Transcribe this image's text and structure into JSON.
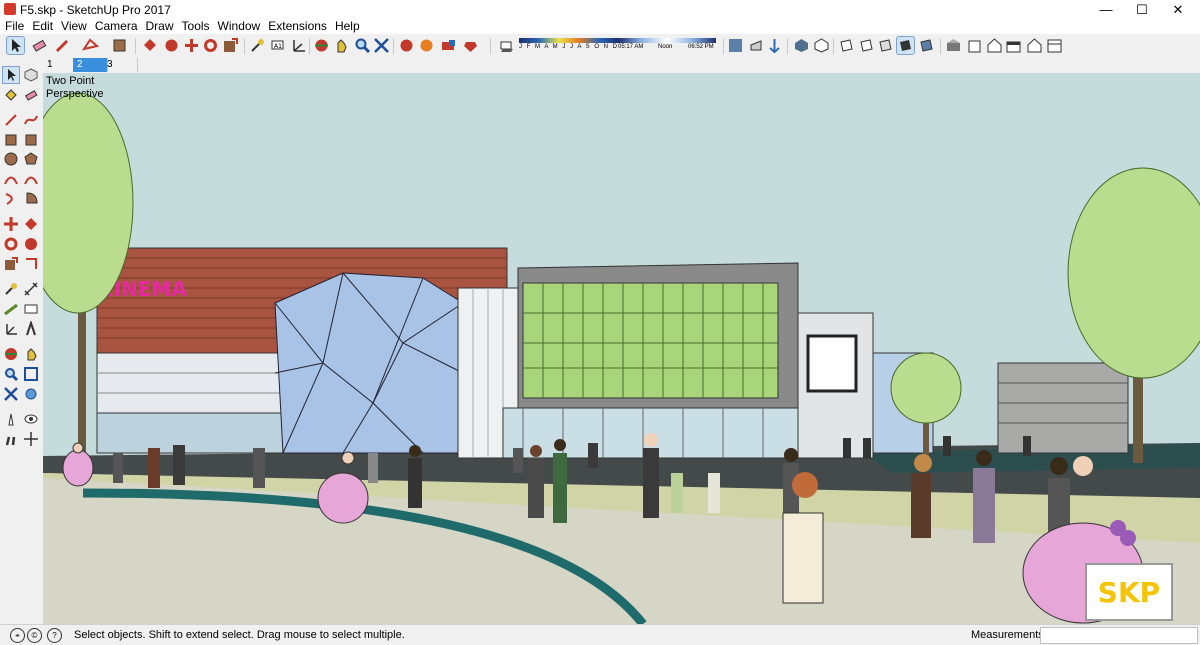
{
  "window": {
    "title": "F5.skp - SketchUp Pro 2017",
    "controls": [
      "—",
      "☐",
      "✕"
    ]
  },
  "menu": [
    "File",
    "Edit",
    "View",
    "Camera",
    "Draw",
    "Tools",
    "Window",
    "Extensions",
    "Help"
  ],
  "shadow_settings": {
    "months_label": "J F M A M J J A S O N D",
    "time_start": "05:17 AM",
    "time_noon": "Noon",
    "time_end": "06:52 PM"
  },
  "scenes": [
    "1",
    "2",
    "3"
  ],
  "active_scene": "2",
  "viewport": {
    "camera_label_line1": "Two Point",
    "camera_label_line2": "Perspective",
    "cinema_sign": "CINEMA",
    "watermark": "SKP"
  },
  "status": {
    "message": "Select objects. Shift to extend select. Drag mouse to select multiple.",
    "measurements_label": "Measurements",
    "measurements_value": ""
  },
  "colors": {
    "sky": "#c6dcdc",
    "ground": "#d6d6c6",
    "cinema_facade": "#a85440",
    "glass_green": "#a8d47a",
    "glass_blue": "#a9c3e6",
    "selection": "#cfe3f7",
    "logo": "#f5c400"
  },
  "toolbar_icons": [
    "select-icon",
    "eraser-icon",
    "pencil-icon",
    "shapes-icon",
    "paint-bucket-icon",
    "push-pull-icon",
    "move-icon",
    "rotate-icon",
    "scale-icon",
    "follow-me-icon",
    "tape-measure-icon",
    "text-icon",
    "axes-icon",
    "orbit-icon",
    "pan-icon",
    "zoom-icon",
    "zoom-extents-icon",
    "warehouse-icon",
    "extension-icon",
    "layer-icon",
    "ruby-icon",
    "shadow-icon",
    "fog-icon",
    "section-icon",
    "style-icon",
    "xray-icon",
    "wireframe-icon",
    "hidden-line-icon",
    "shaded-icon",
    "textured-icon",
    "monochrome-icon",
    "iso-view-icon",
    "top-view-icon",
    "front-view-icon",
    "right-view-icon",
    "back-view-icon",
    "left-view-icon"
  ]
}
